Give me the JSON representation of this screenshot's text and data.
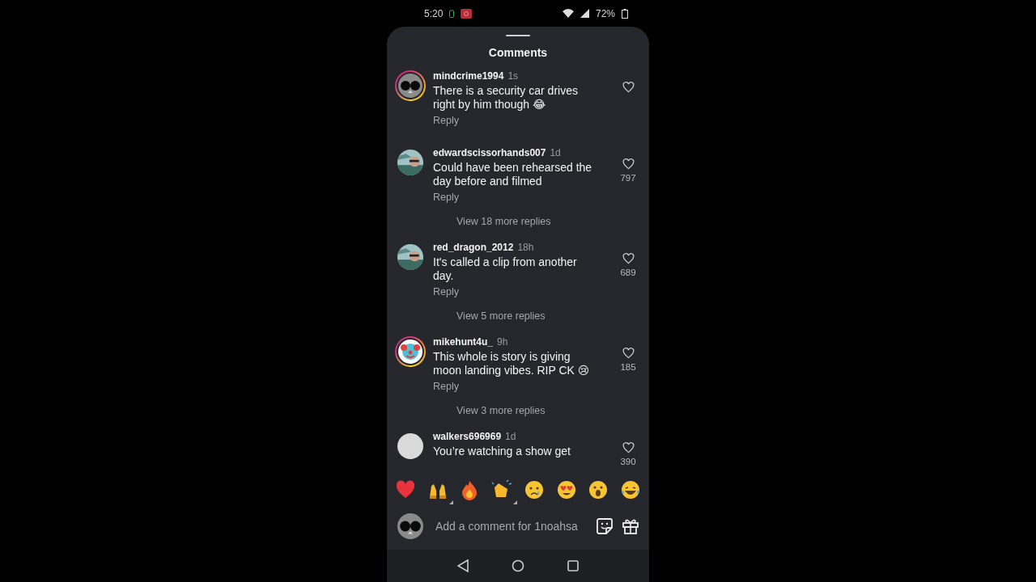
{
  "status_bar": {
    "time": "5:20",
    "battery": "72%"
  },
  "sheet": {
    "title": "Comments"
  },
  "comments": [
    {
      "username": "mindcrime1994",
      "age": "1s",
      "text": "There is a security car drives right by him though 😂",
      "reply": "Reply",
      "story_ring": true
    },
    {
      "username": "edwardscissorhands007",
      "age": "1d",
      "text": "Could have been rehearsed the day before and filmed",
      "reply": "Reply",
      "likes": "797",
      "story_ring": false,
      "more_replies": "View 18 more replies"
    },
    {
      "username": "red_dragon_2012",
      "age": "18h",
      "text": "It's called a clip from another day.",
      "reply": "Reply",
      "likes": "689",
      "story_ring": false,
      "more_replies": "View 5 more replies"
    },
    {
      "username": "mikehunt4u_",
      "age": "9h",
      "text": "This whole is story is giving moon landing vibes. RIP CK 😢",
      "reply": "Reply",
      "likes": "185",
      "story_ring": true,
      "more_replies": "View 3 more replies"
    },
    {
      "username": "walkers696969",
      "age": "1d",
      "text": "You’re watching a show get",
      "likes": "390",
      "story_ring": false
    }
  ],
  "reactions": [
    {
      "kind": "heart",
      "variants": false
    },
    {
      "kind": "hands",
      "variants": true
    },
    {
      "kind": "fire",
      "variants": false
    },
    {
      "kind": "clap",
      "variants": true
    },
    {
      "kind": "cry",
      "variants": false
    },
    {
      "kind": "hearteyes",
      "variants": false
    },
    {
      "kind": "wow",
      "variants": false
    },
    {
      "kind": "laugh",
      "variants": false
    }
  ],
  "composer": {
    "placeholder": "Add a comment for 1noahsa"
  }
}
